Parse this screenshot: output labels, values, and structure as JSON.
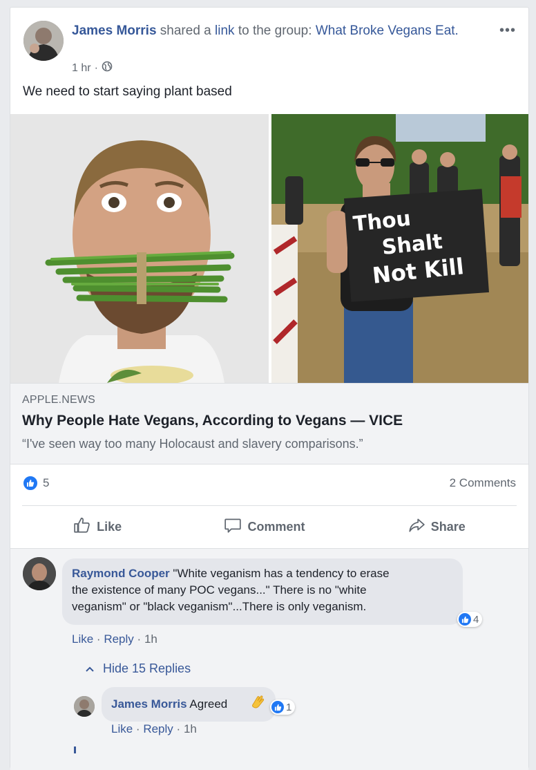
{
  "post": {
    "author": "James Morris",
    "shared_text": "shared a",
    "link_word": "link",
    "to_group_text": "to the group:",
    "group": "What Broke Vegans Eat.",
    "time": "1 hr",
    "time_separator": "·",
    "more_label": "•••",
    "text": "We need to start saying plant based",
    "sign_text": [
      "Thou",
      "Shalt",
      "Not Kill"
    ]
  },
  "link_preview": {
    "domain": "APPLE.NEWS",
    "title": "Why People Hate Vegans, According to Vegans — VICE",
    "description": "“I've seen way too many Holocaust and slavery comparisons.”"
  },
  "engagement": {
    "like_count": "5",
    "comments_count": "2 Comments"
  },
  "actions": {
    "like": "Like",
    "comment": "Comment",
    "share": "Share"
  },
  "comments": [
    {
      "author": "Raymond Cooper",
      "text_line1": "\"White veganism has a tendency to erase",
      "text_line2": "the existence of many POC vegans...\" There is no \"white",
      "text_line3": "veganism\" or \"black veganism\"...There is only veganism.",
      "reaction_count": "4",
      "like_label": "Like",
      "reply_label": "Reply",
      "time": "1h",
      "sep": "·"
    }
  ],
  "hide_replies_label": "Hide 15 Replies",
  "reply": {
    "author": "James Morris",
    "text": "Agreed",
    "reaction_count": "1",
    "like_label": "Like",
    "reply_label": "Reply",
    "time": "1h",
    "sep": "·"
  },
  "colors": {
    "link_blue": "#365899",
    "like_blue": "#2078f4",
    "muted": "#606770"
  }
}
